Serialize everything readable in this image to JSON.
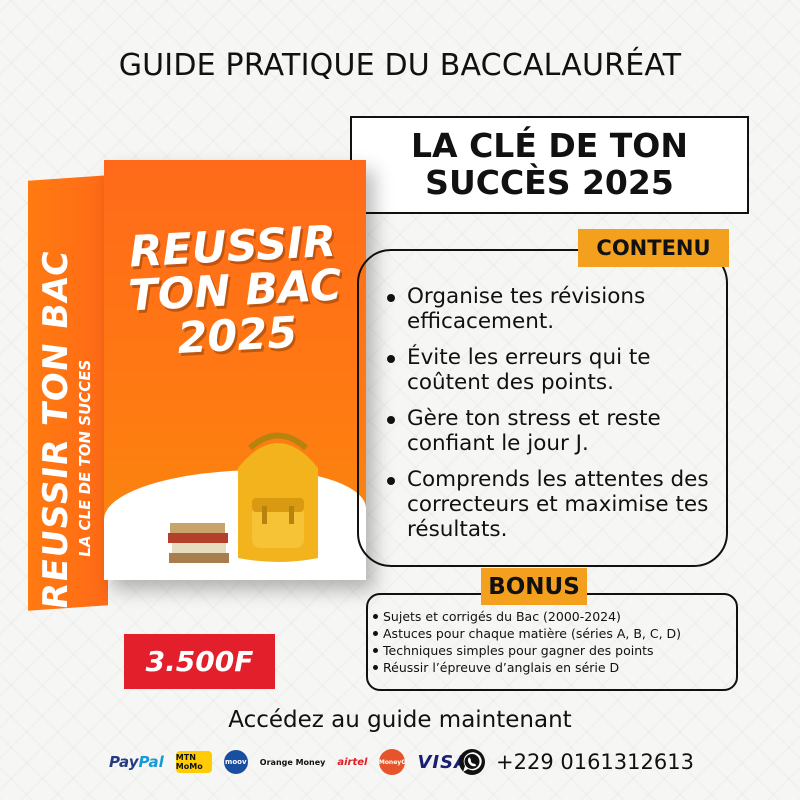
{
  "header": {
    "headline": "GUIDE PRATIQUE DU BACCALAURÉAT",
    "slogan": "LA CLÉ DE TON SUCCÈS 2025"
  },
  "product": {
    "cover_title": "REUSSIR TON BAC 2025",
    "spine_title": "REUSSIR TON BAC",
    "spine_subtitle": "LA CLE DE TON SUCCES",
    "price": "3.500F"
  },
  "content": {
    "label": "CONTENU",
    "items": [
      "Organise tes révisions efficacement.",
      "Évite les erreurs qui te coûtent des points.",
      "Gère ton stress et reste confiant le jour J.",
      "Comprends les attentes des correcteurs et maximise tes résultats."
    ]
  },
  "bonus": {
    "label": "BONUS",
    "items": [
      "Sujets et corrigés du Bac (2000-2024)",
      "Astuces pour chaque matière (séries A, B, C, D)",
      "Techniques simples pour gagner des points",
      "Réussir l’épreuve d’anglais en série D"
    ]
  },
  "footer": {
    "cta": "Accédez au guide maintenant",
    "payments": {
      "paypal_a": "Pay",
      "paypal_b": "Pal",
      "mtn": "MTN MoMo",
      "moov": "moov",
      "orange_money": "Orange Money",
      "airtel": "airtel",
      "moneygram": "MoneyG",
      "visa": "VISA"
    },
    "phone": "+229 0161312613"
  },
  "colors": {
    "accent_orange": "#f4a01f",
    "box_orange": "#ff6a1a",
    "price_red": "#e21f2a",
    "whatsapp_green": "#25d366"
  }
}
